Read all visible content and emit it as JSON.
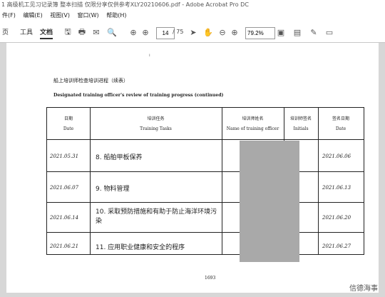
{
  "window": {
    "title": "1 高级机工见习记录簿 整本扫描 仅限分享仅供参考XLY20210606.pdf - Adobe Acrobat Pro DC"
  },
  "menu": [
    "件(F)",
    "编辑(E)",
    "视图(V)",
    "窗口(W)",
    "帮助(H)"
  ],
  "toolbar": {
    "tabs": [
      "页",
      "工具",
      "文档"
    ],
    "current_page": "14",
    "total_pages": "/ 75",
    "zoom": "79.2%"
  },
  "document": {
    "title_cn": "船上培训师检查培训进程（续表）",
    "title_en": "Designated training officer's review of training progress (continued)",
    "headers": {
      "date_cn": "日期",
      "date_en": "Date",
      "task_cn": "培训任务",
      "task_en": "Training Tasks",
      "officer_cn": "培训师姓名",
      "officer_en": "Name of training officer",
      "initials_cn": "培训师签名",
      "initials_en": "Initials",
      "sign_date_cn": "签名日期",
      "sign_date_en": "Date"
    },
    "rows": [
      {
        "date": "2021.05.31",
        "task": "8. 船舶甲板保养",
        "sign_date": "2021.06.06"
      },
      {
        "date": "2021.06.07",
        "task": "9. 物料管理",
        "sign_date": "2021.06.13"
      },
      {
        "date": "2021.06.14",
        "task": "10. 采取预防措施和有助于防止海洋环境污染",
        "sign_date": "2021.06.20"
      },
      {
        "date": "2021.06.21",
        "task": "11. 应用职业健康和安全的程序",
        "sign_date": "2021.06.27"
      }
    ],
    "page_number": "1693"
  },
  "watermark": "信德海事"
}
